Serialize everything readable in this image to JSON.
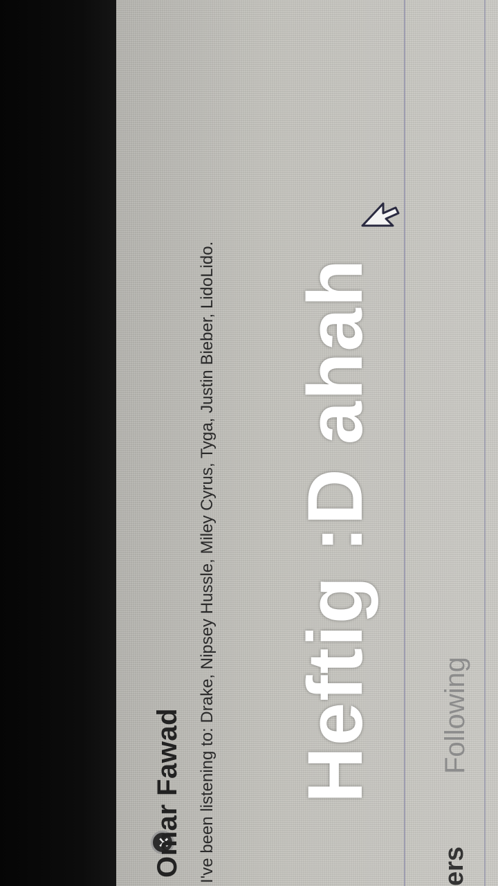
{
  "profile": {
    "name": "Omar Fawad",
    "listening": "I've been listening to: Drake, Nipsey Hussle, Miley Cyrus, Tyga, Justin Bieber, LidoLido."
  },
  "overlay": {
    "caption": "Heftig :D ahah"
  },
  "tabs": {
    "followers_fragment": "ers",
    "following": "Following"
  },
  "controls": {
    "close_glyph": "✕"
  },
  "icons": {
    "close": "close-icon",
    "cursor": "mouse-pointer-icon"
  },
  "colors": {
    "panel": "#c8c7c1",
    "overlay_text": "#ffffff",
    "name_text": "#222222"
  }
}
